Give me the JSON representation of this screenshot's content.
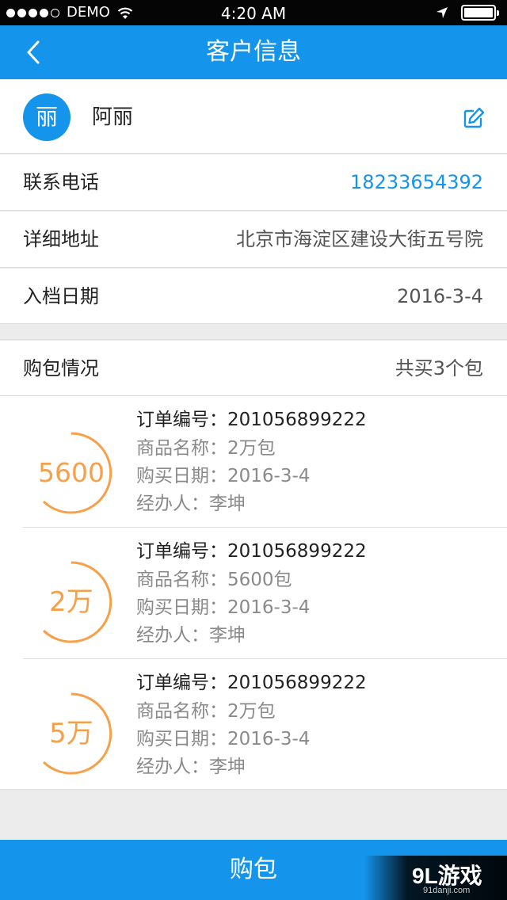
{
  "status_bar": {
    "carrier": "DEMO",
    "time": "4:20 AM",
    "signal_bars_filled": 4,
    "signal_bars_total": 5
  },
  "nav": {
    "title": "客户信息",
    "back_icon": "chevron-left-icon"
  },
  "customer": {
    "avatar_char": "丽",
    "name": "阿丽",
    "edit_icon": "edit-icon"
  },
  "info_rows": [
    {
      "label": "联系电话",
      "value": "18233654392"
    },
    {
      "label": "详细地址",
      "value": "北京市海淀区建设大街五号院"
    },
    {
      "label": "入档日期",
      "value": "2016-3-4"
    }
  ],
  "orders_section": {
    "title": "购包情况",
    "summary": "共买3个包"
  },
  "orders": [
    {
      "badge": "5600",
      "order_no_label": "订单编号：201056899222",
      "product": "商品名称：2万包",
      "date": "购买日期：2016-3-4",
      "handler": "经办人：李坤"
    },
    {
      "badge": "2万",
      "order_no_label": "订单编号：201056899222",
      "product": "商品名称：5600包",
      "date": "购买日期：2016-3-4",
      "handler": "经办人：李坤"
    },
    {
      "badge": "5万",
      "order_no_label": "订单编号：201056899222",
      "product": "商品名称：2万包",
      "date": "购买日期：2016-3-4",
      "handler": "经办人：李坤"
    }
  ],
  "buy_button": {
    "label": "购包"
  },
  "watermark": {
    "main": "9L游戏",
    "sub": "91danji.com"
  },
  "colors": {
    "primary": "#1494ea",
    "ring": "#f6a04a"
  }
}
